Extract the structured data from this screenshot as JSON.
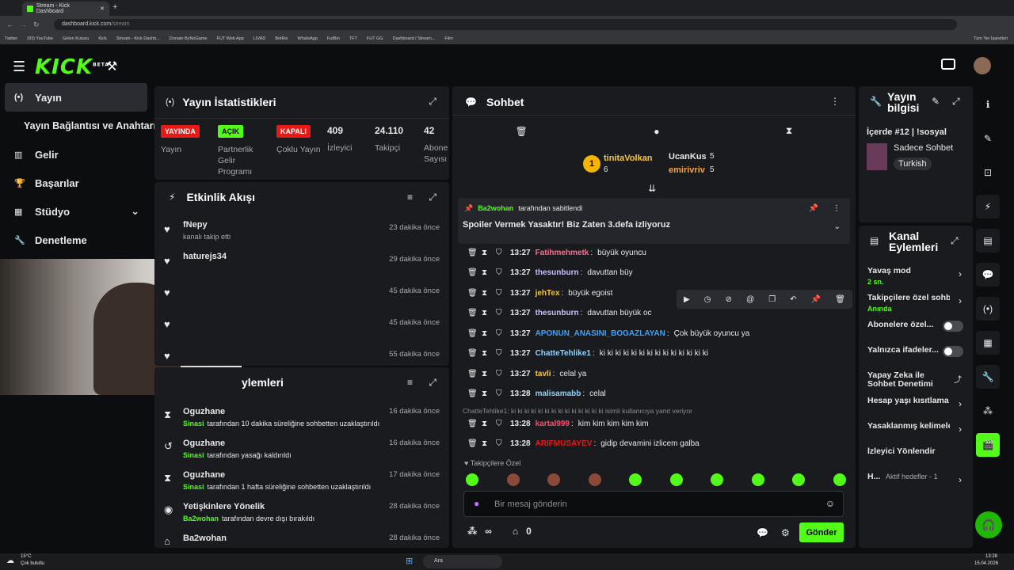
{
  "browser": {
    "tab_title": "Stream - Kick Dashboard",
    "url_host": "dashboard.kick.com",
    "url_path": "/stream",
    "bookmarks": [
      "Twitter",
      "(93) YouTube",
      "Gelen Kutusu",
      "Kick",
      "Stream - Kick Dashb...",
      "Donate ByNoGame",
      "FUT Web App",
      "LIVAD",
      "BotRix",
      "WhatsApp",
      "FutBin",
      "TFT",
      "FUT GG",
      "Dashboard / Stream...",
      "Film"
    ],
    "all_bookmarks": "Tüm Yer İşaretleri"
  },
  "logo": {
    "text": "KICK",
    "beta": "BETA"
  },
  "sidebar": {
    "items": [
      {
        "label": "Yayın",
        "icon": "broadcast-icon"
      },
      {
        "label": "Yayın Bağlantısı ve Anahtarı",
        "icon": ""
      },
      {
        "label": "Gelir",
        "icon": "chart-icon"
      },
      {
        "label": "Başarılar",
        "icon": "trophy-icon"
      },
      {
        "label": "Stüdyo",
        "icon": "studio-icon"
      },
      {
        "label": "Denetleme",
        "icon": "wrench-icon"
      }
    ]
  },
  "stats": {
    "title": "Yayın İstatistikleri",
    "items": [
      {
        "badge": "YAYINDA",
        "label": "Yayın",
        "badge_color": "#e91916"
      },
      {
        "badge": "AÇIK",
        "label": "Partnerlik Gelir Programı",
        "badge_color": "#53fc18"
      },
      {
        "badge": "KAPALI",
        "label": "Çoklu Yayın",
        "badge_color": "#e91916"
      },
      {
        "value": "409",
        "label": "İzleyici"
      },
      {
        "value": "24.110",
        "label": "Takipçi"
      },
      {
        "value": "42",
        "label": "Abone Sayısı"
      }
    ]
  },
  "activity": {
    "title": "Etkinlik Akışı",
    "items": [
      {
        "name": "fNepy",
        "desc": "kanalı takip etti",
        "time": "23 dakika önce"
      },
      {
        "name": "haturejs34",
        "desc": "",
        "time": "29 dakika önce"
      },
      {
        "name": "",
        "desc": "",
        "time": "45 dakika önce"
      },
      {
        "name": "",
        "desc": "",
        "time": "45 dakika önce"
      },
      {
        "name": "",
        "desc": "",
        "time": "55 dakika önce"
      }
    ]
  },
  "mod_actions": {
    "title": "ylemleri",
    "items": [
      {
        "name": "Oguzhane",
        "actor": "Sinasi",
        "desc": "tarafından 10 dakika süreliğine sohbetten uzaklaştırıldı",
        "time": "16 dakika önce",
        "icon": "hourglass-icon"
      },
      {
        "name": "Oguzhane",
        "actor": "Sinasi",
        "desc": "tarafından yasağı kaldırıldı",
        "time": "16 dakika önce",
        "icon": "undo-icon"
      },
      {
        "name": "Oguzhane",
        "actor": "Sinasi",
        "desc": "tarafından 1 hafta süreliğine sohbetten uzaklaştırıldı",
        "time": "17 dakika önce",
        "icon": "hourglass-icon"
      },
      {
        "name": "Yetişkinlere Yönelik",
        "actor": "Ba2wohan",
        "desc": "tarafından devre dışı bırakıldı",
        "time": "28 dakika önce",
        "icon": "eye-icon"
      },
      {
        "name": "Ba2wohan",
        "actor": "",
        "desc": "",
        "time": "28 dakika önce",
        "icon": "store-icon"
      }
    ]
  },
  "chat": {
    "title": "Sohbet",
    "leaders": [
      {
        "rank": "1",
        "name": "tinitaVolkan",
        "count": "6"
      },
      {
        "name": "UcanKus",
        "count": "5"
      },
      {
        "name": "emirivriv",
        "count": "5"
      }
    ],
    "pinned": {
      "by": "Ba2wohan",
      "by_suffix": "tarafından sabitlendi",
      "text": "Spoiler Vermek Yasaktır! Biz Zaten 3.defa izliyoruz"
    },
    "messages": [
      {
        "time": "13:27",
        "user": "Fatihmehmetk",
        "color": "#ff6b8a",
        "text": "büyük oyuncu"
      },
      {
        "time": "13:27",
        "user": "thesunburn",
        "color": "#c6c0ff",
        "text": "davuttan büy"
      },
      {
        "time": "13:27",
        "user": "jehTex",
        "color": "#f5c542",
        "text": "büyük egoist"
      },
      {
        "time": "13:27",
        "user": "thesunburn",
        "color": "#c6c0ff",
        "text": "davuttan büyük oc"
      },
      {
        "time": "13:27",
        "user": "APONUN_ANASINI_BOGAZLAYAN",
        "color": "#3aa3ff",
        "text": "Çok büyük oyuncu ya"
      },
      {
        "time": "13:27",
        "user": "ChatteTehlike1",
        "color": "#8fd3ff",
        "text": "ki ki ki ki ki ki ki ki ki ki ki ki ki ki"
      },
      {
        "time": "13:27",
        "user": "tavli",
        "color": "#f5c542",
        "text": "celal ya"
      },
      {
        "time": "13:28",
        "user": "malisamabb",
        "color": "#8fd3ff",
        "text": "celal"
      }
    ],
    "reply_note": "ChatteTehlike1: ki ki ki ki ki ki ki ki ki ki ki ki ki ki isimli kullanıcıya yanıt veriyor",
    "messages2": [
      {
        "time": "13:28",
        "user": "kartal999",
        "color": "#ff4d6d",
        "text": "kim kim kim kim kim"
      },
      {
        "time": "13:28",
        "user": "ARIFMUSAYEV",
        "color": "#e91916",
        "text": "gidip devamini izlicem galba"
      }
    ],
    "followers_only": "Takipçilere Özel",
    "input_placeholder": "Bir mesaj gönderin",
    "infinity": "∞",
    "count": "0",
    "send": "Gönder"
  },
  "stream_info": {
    "title": "Yayın bilgisi",
    "stream_title": "İçerde #12 | !sosyal",
    "category": "Sadece Sohbet",
    "language": "Turkish"
  },
  "channel_actions": {
    "title": "Kanal Eylemleri",
    "items": [
      {
        "label": "Yavaş mod",
        "sub": "2 sn.",
        "type": "chevron"
      },
      {
        "label": "Takipçilere özel sohbet",
        "sub": "Anında",
        "type": "chevron"
      },
      {
        "label": "Abonelere özel...",
        "type": "toggle"
      },
      {
        "label": "Yalnızca ifadeler...",
        "type": "toggle"
      },
      {
        "label": "Yapay Zeka ile Sohbet Denetimi",
        "type": "link"
      },
      {
        "label": "Hesap yaşı kısıtlama",
        "type": "chevron"
      },
      {
        "label": "Yasaklanmış kelimeler",
        "type": "chevron"
      },
      {
        "label": "İzleyici Yönlendir",
        "type": "none"
      },
      {
        "label": "H...",
        "sub": "Aktif hedefler - 1",
        "type": "chevron"
      }
    ]
  },
  "taskbar": {
    "weather_temp": "15°C",
    "weather_desc": "Çok bulutlu",
    "search": "Ara",
    "time": "13:28",
    "date": "15.04.2026"
  },
  "colors": {
    "accent": "#53fc18",
    "danger": "#e91916",
    "panel": "#191b1f",
    "bg": "#0b0d0e"
  }
}
